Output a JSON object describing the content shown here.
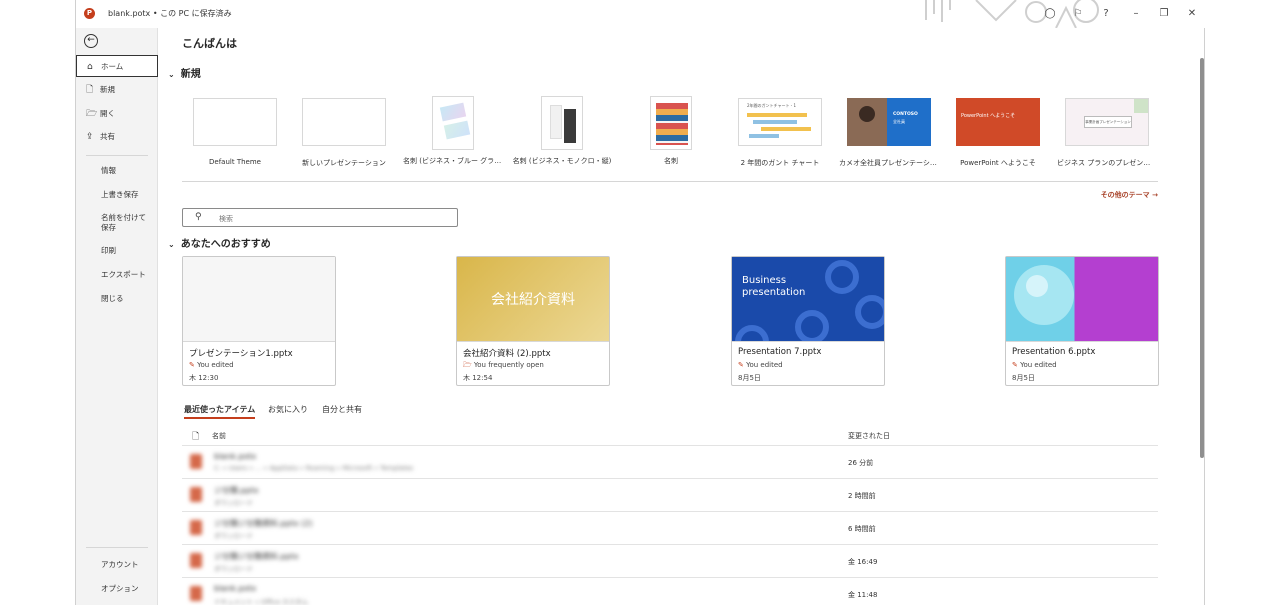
{
  "titlebar": {
    "logo": "P",
    "title": "blank.potx • この PC に保存済み"
  },
  "sidebar": {
    "top": [
      {
        "label": "ホーム",
        "icon": "⌂"
      },
      {
        "label": "新規",
        "icon": "🗋"
      },
      {
        "label": "開く",
        "icon": "🗁"
      },
      {
        "label": "共有",
        "icon": "⇪"
      }
    ],
    "middle": [
      "情報",
      "上書き保存",
      "名前を付けて保存",
      "印刷",
      "エクスポート",
      "閉じる"
    ],
    "bottom": [
      "アカウント",
      "オプション"
    ]
  },
  "main": {
    "greeting": "こんばんは",
    "new_title": "新規",
    "templates": [
      {
        "label": "Default Theme"
      },
      {
        "label": "新しいプレゼンテーション"
      },
      {
        "label": "名刺 (ビジネス・ブルー グラデ…"
      },
      {
        "label": "名刺 (ビジネス・モノクロ・縦)"
      },
      {
        "label": "名刺"
      },
      {
        "label": "2 年間のガント チャート"
      },
      {
        "label": "カメオ全社員プレゼンテーション"
      },
      {
        "label": "PowerPoint へようこそ"
      },
      {
        "label": "ビジネス プランのプレゼンテーショ…"
      }
    ],
    "thumb_text": {
      "gantt": "2年間のガントチャート - 1",
      "contoso": "CONTOSO",
      "contoso_sub": "全社員",
      "welcome": "PowerPoint へようこそ",
      "bizplan": "事業計画プレゼンテーション"
    },
    "more_themes": "その他のテーマ →",
    "search_placeholder": "検索",
    "recommend_title": "あなたへのおすすめ",
    "cards": [
      {
        "name": "プレゼンテーション1.pptx",
        "sub": "You edited",
        "date": "木 12:30",
        "thumb": "",
        "sub_icon": "✎"
      },
      {
        "name": "会社紹介資料 (2).pptx",
        "sub": "You frequently open",
        "date": "木 12:54",
        "thumb": "会社紹介資料",
        "sub_icon": "🗁"
      },
      {
        "name": "Presentation 7.pptx",
        "sub": "You edited",
        "date": "8月5日",
        "thumb": "Business presentation",
        "sub_icon": "✎"
      },
      {
        "name": "Presentation 6.pptx",
        "sub": "You edited",
        "date": "8月5日",
        "thumb": "",
        "sub_icon": "✎"
      }
    ],
    "tabs": [
      "最近使ったアイテム",
      "お気に入り",
      "自分と共有"
    ],
    "list": {
      "col_name": "名前",
      "col_date": "変更された日",
      "rows": [
        {
          "name": "blank.potx",
          "path": "C: » Users » ... » AppData » Roaming » Microsoft » Templates",
          "date": "26 分前"
        },
        {
          "name": "ジ分類.pptx",
          "path": "ダウンロード",
          "date": "2 時間前"
        },
        {
          "name": "ジ分類ジ分類資料.pptx (2)",
          "path": "ダウンロード",
          "date": "6 時間前"
        },
        {
          "name": "ジ分類ジ分類資料.pptx",
          "path": "ダウンロード",
          "date": "金 16:49"
        },
        {
          "name": "blank.potx",
          "path": "ドキュメント » Office カスタム",
          "date": "金 11:48"
        }
      ]
    }
  },
  "colors": {
    "accent": "#c43e1c",
    "link": "#a8432a"
  }
}
